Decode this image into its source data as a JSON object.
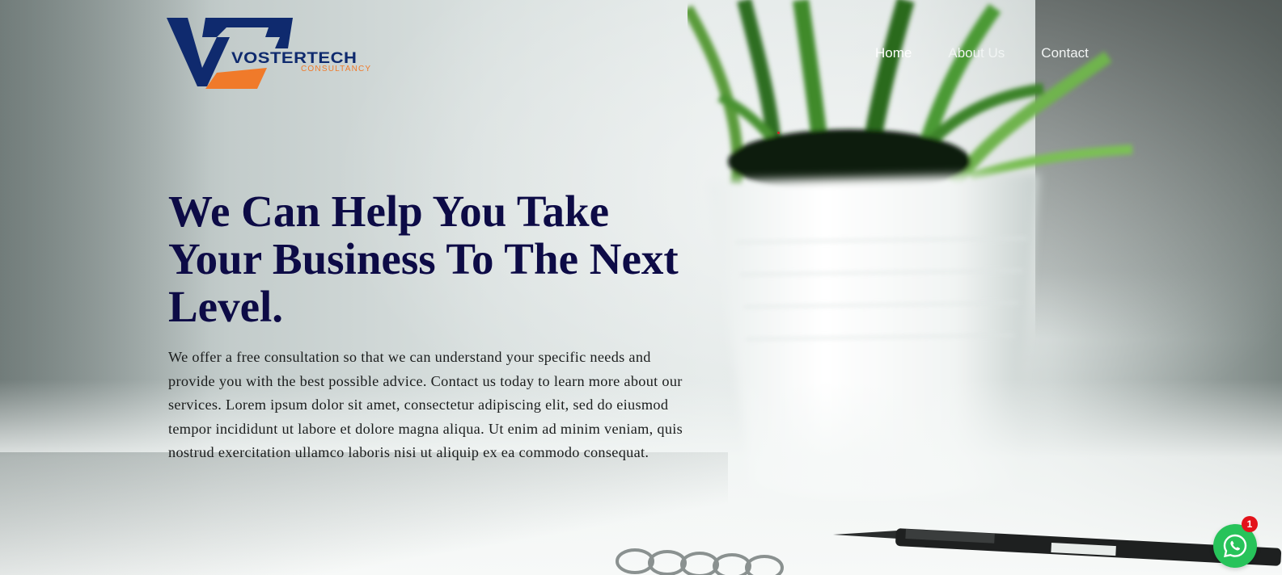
{
  "brand": {
    "name": "VOSTERTECH",
    "tagline": "CONSULTANCY",
    "colors": {
      "navy": "#0f2a6e",
      "orange": "#f07a2a"
    }
  },
  "nav": {
    "items": [
      {
        "label": "Home",
        "active": true
      },
      {
        "label": "About Us",
        "active": false
      },
      {
        "label": "Contact",
        "active": false
      }
    ]
  },
  "hero": {
    "headline": "We Can Help You Take Your Business To The Next Level.",
    "description": "We offer a free consultation so that we can understand your specific needs and provide you with the best possible advice. Contact us today to learn more about our services. Lorem ipsum dolor sit amet, consectetur adipiscing elit, sed do eiusmod tempor incididunt ut labore et dolore magna aliqua. Ut enim ad minim veniam, quis nostrud exercitation ullamco laboris nisi ut aliquip ex ea commodo consequat.",
    "colors": {
      "headline": "#0d0b46",
      "body": "#1b1d1d"
    }
  },
  "whatsapp": {
    "icon": "whatsapp-icon",
    "badge_count": "1",
    "colors": {
      "button": "#27c35a",
      "badge": "#e3121a"
    }
  }
}
